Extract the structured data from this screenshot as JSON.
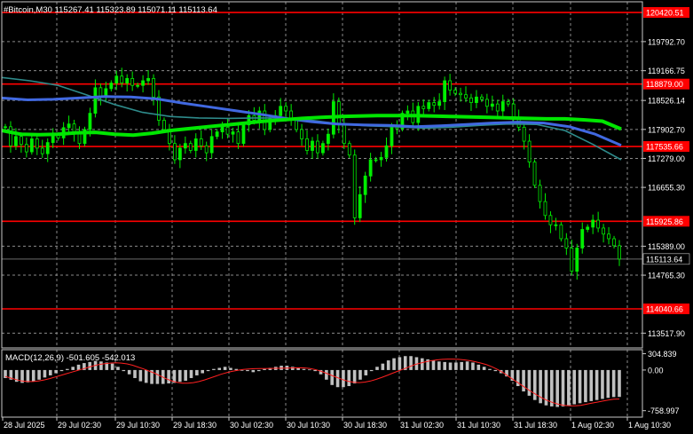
{
  "header": {
    "symbol_line": "#Bitcoin,M30  115267.41 115323.89 115071.11 115113.64"
  },
  "colors": {
    "background": "#000000",
    "grid": "#8a8a8a",
    "frame": "#c8c8c8",
    "candle": "#00ee00",
    "ma_fast": "#00e600",
    "ma_mid": "#4169e1",
    "ma_slow": "#2e8b8b",
    "level_line": "#ff0000",
    "macd_hist": "#c0c0c0",
    "macd_signal": "#ff2020",
    "label_text": "#ffffff"
  },
  "chart_data": [
    {
      "type": "line",
      "title": "#Bitcoin,M30",
      "ohlc_readout": {
        "open": 115267.41,
        "high": 115323.89,
        "low": 115071.11,
        "close": 115113.64
      },
      "ylim": [
        113200,
        120650
      ],
      "y_ticks": [
        "119792.70",
        "119166.75",
        "118526.14",
        "117902.70",
        "117279.00",
        "116655.30",
        "115389.00",
        "114765.30",
        "113517.90"
      ],
      "x_ticks": [
        "28 Jul 2025",
        "29 Jul 02:30",
        "29 Jul 10:30",
        "29 Jul 18:30",
        "30 Jul 02:30",
        "30 Jul 10:30",
        "30 Jul 18:30",
        "31 Jul 02:30",
        "31 Jul 10:30",
        "31 Jul 18:30",
        "1 Aug 02:30",
        "1 Aug 10:30"
      ],
      "levels": [
        {
          "value": 120420.51,
          "label": "120420.51"
        },
        {
          "value": 118879.0,
          "label": "118879.00"
        },
        {
          "value": 117535.66,
          "label": "117535.66"
        },
        {
          "value": 115925.86,
          "label": "115925.86"
        },
        {
          "value": 114040.66,
          "label": "114040.66"
        }
      ],
      "current_price": {
        "value": 115113.64,
        "label": "115113.64"
      },
      "series": [
        {
          "role": "price",
          "values": [
            117960,
            117550,
            117750,
            117580,
            117420,
            117700,
            117500,
            117380,
            117620,
            117780,
            117720,
            117940,
            118020,
            117820,
            117600,
            117900,
            118250,
            118800,
            118600,
            118780,
            118900,
            119050,
            118900,
            119000,
            118850,
            118850,
            118950,
            119000,
            118600,
            118100,
            117900,
            117600,
            117250,
            117500,
            117600,
            117450,
            117700,
            117550,
            117400,
            117750,
            117850,
            117950,
            117800,
            117850,
            117600,
            118000,
            118200,
            118100,
            118300,
            117900,
            118150,
            118200,
            118400,
            118300,
            118100,
            117900,
            117700,
            117450,
            117650,
            117400,
            117600,
            117800,
            118500,
            118000,
            117600,
            117350,
            116000,
            116500,
            116900,
            117250,
            117250,
            117300,
            117550,
            117950,
            117920,
            118250,
            118300,
            118050,
            118400,
            118350,
            118480,
            118420,
            118500,
            118950,
            118750,
            118680,
            118650,
            118580,
            118480,
            118600,
            118550,
            118400,
            118450,
            118300,
            118500,
            118450,
            118150,
            117950,
            117650,
            117200,
            116700,
            116350,
            116050,
            115850,
            115850,
            115550,
            115350,
            114850,
            115350,
            115750,
            115800,
            115950,
            115780,
            115650,
            115550,
            115400,
            115113
          ]
        },
        {
          "role": "moving-average-fast",
          "values": [
            117880,
            117800,
            117790,
            117800,
            117830,
            117840,
            117800,
            117780,
            117820,
            117880,
            117920,
            117960,
            118000,
            118040,
            118080,
            118110,
            118140,
            118160,
            118180,
            118190,
            118200,
            118200,
            118200,
            118190,
            118180,
            118170,
            118160,
            118150,
            118140,
            118130,
            118130,
            118110,
            118080,
            117910
          ]
        },
        {
          "role": "moving-average-mid",
          "values": [
            118580,
            118540,
            118550,
            118580,
            118610,
            118600,
            118560,
            118470,
            118390,
            118310,
            118230,
            118140,
            118070,
            118020,
            118000,
            117990,
            117960,
            117980,
            118010,
            118040,
            118060,
            118040,
            117960,
            117800,
            117560
          ]
        },
        {
          "role": "moving-average-slow",
          "values": [
            119020,
            118950,
            118850,
            118650,
            118440,
            118270,
            118180,
            118150,
            118140,
            118150,
            118150,
            118100,
            118020,
            117980,
            117960,
            117930,
            117950,
            117990,
            118020,
            118010,
            117880,
            117580,
            117250
          ]
        }
      ]
    },
    {
      "type": "bar",
      "title": "MACD(12,26,9) -501.605 -542.013",
      "ylim": [
        -880,
        380
      ],
      "y_ticks": [
        "304.839",
        "0.00",
        "-758.997"
      ],
      "series": [
        {
          "role": "macd-histogram",
          "values": [
            -150,
            -180,
            -220,
            -240,
            -230,
            -210,
            -180,
            -140,
            -100,
            -60,
            -20,
            20,
            60,
            100,
            130,
            150,
            170,
            160,
            140,
            120,
            60,
            -20,
            -80,
            -150,
            -210,
            -240,
            -260,
            -260,
            -260,
            -250,
            -240,
            -220,
            -200,
            -150,
            -100,
            -60,
            -20,
            20,
            40,
            60,
            40,
            20,
            0,
            -20,
            -40,
            -20,
            20,
            40,
            60,
            80,
            80,
            60,
            40,
            20,
            10,
            -20,
            -80,
            -180,
            -280,
            -320,
            -320,
            -300,
            -250,
            -180,
            -100,
            -20,
            60,
            120,
            180,
            220,
            240,
            260,
            260,
            240,
            220,
            200,
            180,
            160,
            150,
            140,
            140,
            150,
            160,
            140,
            100,
            60,
            20,
            -20,
            -60,
            -120,
            -200,
            -300,
            -400,
            -480,
            -560,
            -620,
            -660,
            -680,
            -690,
            -680,
            -660,
            -640,
            -620,
            -600,
            -580,
            -560,
            -540,
            -520,
            -505,
            -502
          ]
        },
        {
          "role": "macd-signal",
          "values": [
            -120,
            -150,
            -180,
            -205,
            -215,
            -215,
            -205,
            -185,
            -160,
            -130,
            -100,
            -70,
            -40,
            -10,
            20,
            50,
            80,
            105,
            120,
            130,
            135,
            130,
            115,
            90,
            55,
            20,
            -20,
            -60,
            -110,
            -160,
            -200,
            -230,
            -245,
            -245,
            -235,
            -215,
            -185,
            -150,
            -115,
            -80,
            -50,
            -25,
            -5,
            10,
            20,
            25,
            27,
            28,
            30,
            32,
            34,
            36,
            40,
            42,
            40,
            30,
            10,
            -20,
            -60,
            -100,
            -140,
            -180,
            -210,
            -230,
            -235,
            -225,
            -205,
            -175,
            -140,
            -100,
            -60,
            -20,
            20,
            60,
            100,
            130,
            155,
            175,
            190,
            200,
            205,
            205,
            200,
            190,
            175,
            155,
            130,
            100,
            60,
            10,
            -50,
            -120,
            -190,
            -260,
            -330,
            -400,
            -460,
            -520,
            -570,
            -610,
            -640,
            -660,
            -670,
            -670,
            -660,
            -640,
            -620,
            -600,
            -580,
            -560,
            -545,
            -542
          ]
        }
      ]
    }
  ]
}
